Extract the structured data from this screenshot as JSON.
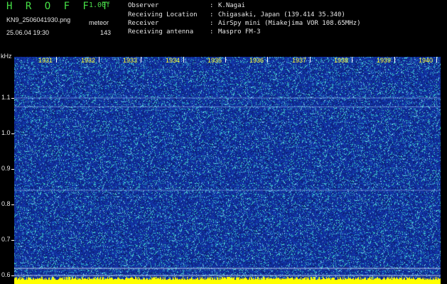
{
  "header": {
    "app_title": "HROFFT",
    "version": "1.00f",
    "file_name": "KN9_2506041930.png",
    "mode": "meteor",
    "datetime": "25.06.04 19:30",
    "count": "143",
    "observer_key": "Observer",
    "observer_value": "K.Nagai",
    "location_key": "Receiving Location",
    "location_value": "Chigasaki, Japan (139.414 35.340)",
    "receiver_key": "Receiver",
    "receiver_value": "AirSpy mini (Miakejima VOR 108.65MHz)",
    "antenna_key": "Receiving antenna",
    "antenna_value": "Maspro FM-3",
    "separator": ":"
  },
  "spectrogram": {
    "y_unit": "kHz",
    "y_ticks": [
      "1.1",
      "1.0",
      "0.9",
      "0.8",
      "0.7",
      "0.6"
    ],
    "y_tick_values": [
      1.1,
      1.0,
      0.9,
      0.8,
      0.7,
      0.6
    ],
    "y_range_khz": [
      0.575,
      1.215
    ],
    "x_ticks": [
      "1931",
      "1932",
      "1933",
      "1934",
      "1935",
      "1936",
      "1937",
      "1938",
      "1939",
      "1940"
    ],
    "x_tick_minutes": [
      31,
      32,
      33,
      34,
      35,
      36,
      37,
      38,
      39,
      40
    ],
    "x_range_minutes": [
      30.0,
      40.1
    ],
    "colors": {
      "background": "#1235a8",
      "noise_cyan": "#3fe0d0",
      "noise_light": "#8ee8ff",
      "noise_dark": "#0a1c6e",
      "label_yellow": "#ffff33",
      "bottom_band": "#ffff00"
    }
  }
}
